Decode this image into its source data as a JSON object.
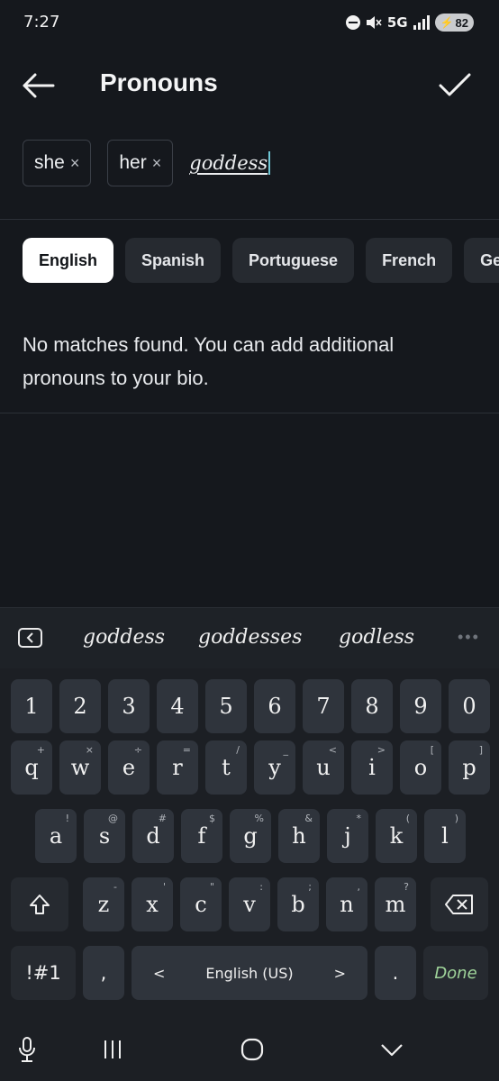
{
  "status_bar": {
    "time": "7:27",
    "network": "5G",
    "battery": "82"
  },
  "header": {
    "title": "Pronouns"
  },
  "pronouns": {
    "chips": [
      {
        "label": "she",
        "remove": "×"
      },
      {
        "label": "her",
        "remove": "×"
      }
    ],
    "input_value": "goddess"
  },
  "language_tabs": [
    {
      "label": "English",
      "active": true
    },
    {
      "label": "Spanish",
      "active": false
    },
    {
      "label": "Portuguese",
      "active": false
    },
    {
      "label": "French",
      "active": false
    },
    {
      "label": "Ge",
      "active": false
    }
  ],
  "message": "No matches found. You can add additional pronouns to your bio.",
  "keyboard": {
    "suggestions": [
      "goddess",
      "goddesses",
      "godless"
    ],
    "number_row": [
      "1",
      "2",
      "3",
      "4",
      "5",
      "6",
      "7",
      "8",
      "9",
      "0"
    ],
    "row1": [
      {
        "key": "q",
        "sec": "+"
      },
      {
        "key": "w",
        "sec": "×"
      },
      {
        "key": "e",
        "sec": "÷"
      },
      {
        "key": "r",
        "sec": "="
      },
      {
        "key": "t",
        "sec": "/"
      },
      {
        "key": "y",
        "sec": "_"
      },
      {
        "key": "u",
        "sec": "<"
      },
      {
        "key": "i",
        "sec": ">"
      },
      {
        "key": "o",
        "sec": "["
      },
      {
        "key": "p",
        "sec": "]"
      }
    ],
    "row2": [
      {
        "key": "a",
        "sec": "!"
      },
      {
        "key": "s",
        "sec": "@"
      },
      {
        "key": "d",
        "sec": "#"
      },
      {
        "key": "f",
        "sec": "$"
      },
      {
        "key": "g",
        "sec": "%"
      },
      {
        "key": "h",
        "sec": "&"
      },
      {
        "key": "j",
        "sec": "*"
      },
      {
        "key": "k",
        "sec": "("
      },
      {
        "key": "l",
        "sec": ")"
      }
    ],
    "row3": [
      {
        "key": "z",
        "sec": "-"
      },
      {
        "key": "x",
        "sec": "'"
      },
      {
        "key": "c",
        "sec": "\""
      },
      {
        "key": "v",
        "sec": ":"
      },
      {
        "key": "b",
        "sec": ";"
      },
      {
        "key": "n",
        "sec": ","
      },
      {
        "key": "m",
        "sec": "?"
      }
    ],
    "symbols_label": "!#1",
    "comma_label": ",",
    "space_label": "English (US)",
    "space_left": "<",
    "space_right": ">",
    "period_label": ".",
    "done_label": "Done"
  },
  "icons": {
    "back": "arrow-left",
    "confirm": "checkmark",
    "shift": "shift-arrow",
    "backspace": "backspace",
    "mic": "microphone",
    "recents": "recent-apps",
    "home": "home",
    "nav_back": "chevron-down"
  }
}
